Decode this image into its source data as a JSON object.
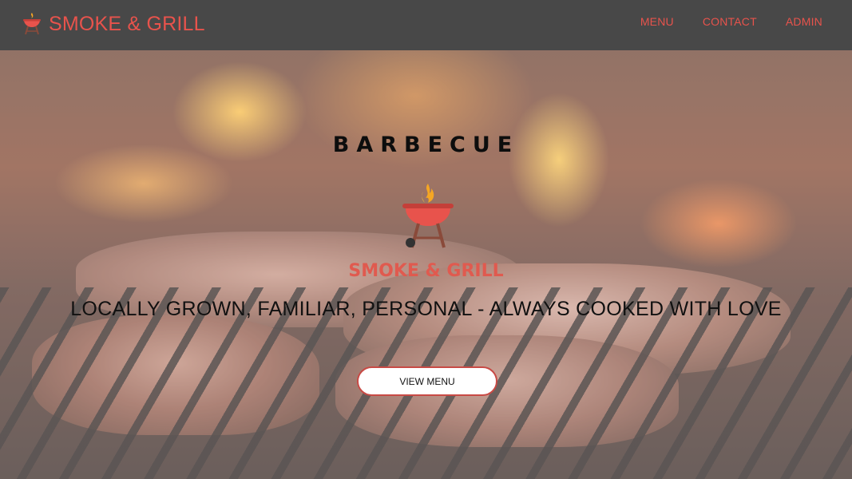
{
  "nav": {
    "brand_name": "SMOKE & GRILL",
    "brand_logo_icon": "bbq-grill-icon",
    "links": [
      "MENU",
      "CONTACT",
      "ADMIN"
    ]
  },
  "hero": {
    "kicker": "BARBECUE",
    "logo_icon": "bbq-grill-flame-icon",
    "brand": "SMOKE & GRILL",
    "tagline": "LOCALLY GROWN, FAMILIAR, PERSONAL - ALWAYS COOKED WITH LOVE",
    "cta_label": "VIEW MENU",
    "background_image": "grilling-steaks-over-fire"
  },
  "colors": {
    "navbar_bg": "#484848",
    "brand_red": "#e8534c",
    "button_border": "#c84a45",
    "text_dark": "#111111"
  }
}
